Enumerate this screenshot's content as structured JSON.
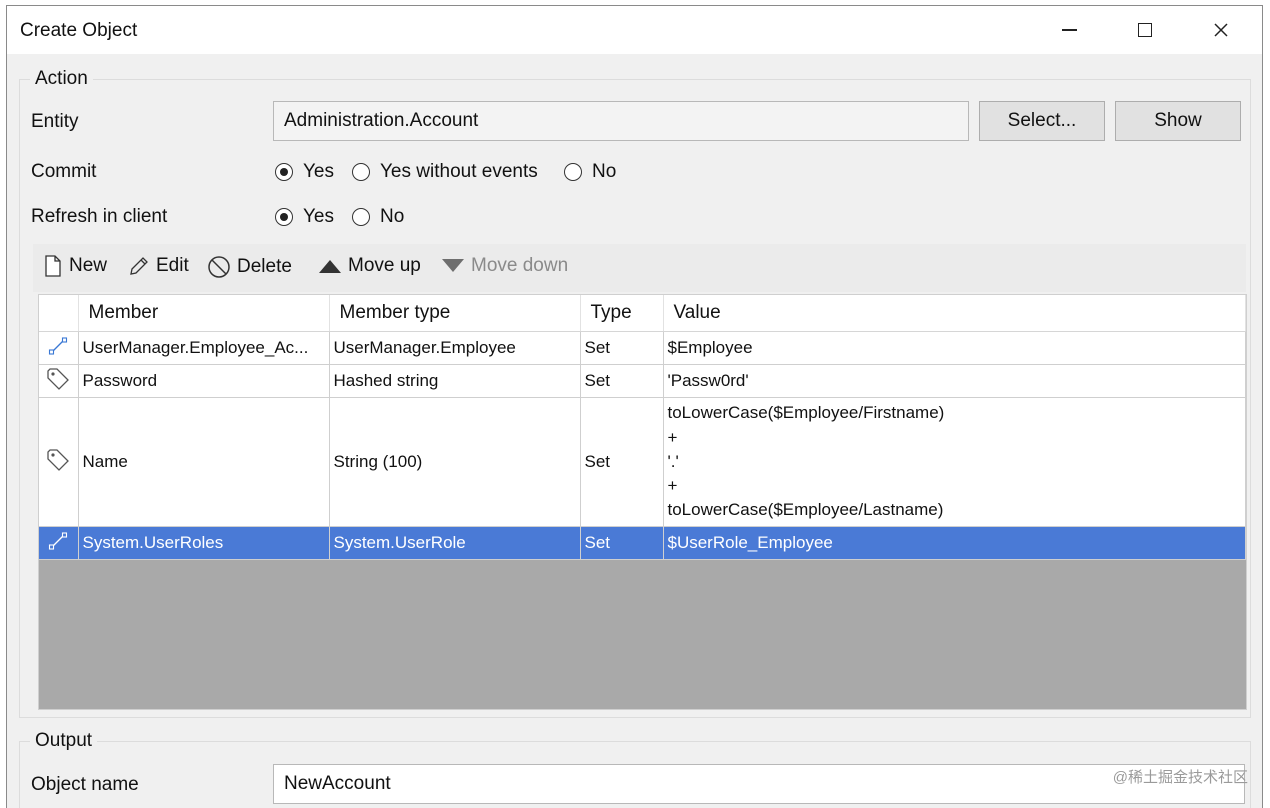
{
  "window": {
    "title": "Create Object",
    "controls": {
      "minimize": "minimize-icon",
      "maximize": "maximize-icon",
      "close": "close-icon"
    }
  },
  "action": {
    "legend": "Action",
    "entity": {
      "label": "Entity",
      "value": "Administration.Account",
      "select_label": "Select...",
      "show_label": "Show"
    },
    "commit": {
      "label": "Commit",
      "options": [
        {
          "label": "Yes",
          "checked": true
        },
        {
          "label": "Yes without events",
          "checked": false
        },
        {
          "label": "No",
          "checked": false
        }
      ]
    },
    "refresh": {
      "label": "Refresh in client",
      "options": [
        {
          "label": "Yes",
          "checked": true
        },
        {
          "label": "No",
          "checked": false
        }
      ]
    },
    "toolbar": {
      "new": "New",
      "edit": "Edit",
      "delete": "Delete",
      "move_up": "Move up",
      "move_down": "Move down"
    },
    "grid": {
      "columns": [
        "Member",
        "Member type",
        "Type",
        "Value"
      ],
      "rows": [
        {
          "icon": "association-icon",
          "member": "UserManager.Employee_Ac...",
          "member_type": "UserManager.Employee",
          "type": "Set",
          "value": "$Employee"
        },
        {
          "icon": "attribute-tag-icon",
          "member": "Password",
          "member_type": "Hashed string",
          "type": "Set",
          "value": "'Passw0rd'"
        },
        {
          "icon": "attribute-tag-icon",
          "member": "Name",
          "member_type": "String (100)",
          "type": "Set",
          "value_lines": [
            "toLowerCase($Employee/Firstname)",
            "+",
            "'.'",
            "+",
            "toLowerCase($Employee/Lastname)"
          ]
        },
        {
          "icon": "association-icon",
          "member": "System.UserRoles",
          "member_type": "System.UserRole",
          "type": "Set",
          "value": "$UserRole_Employee",
          "selected": true
        }
      ]
    }
  },
  "output": {
    "legend": "Output",
    "object_name": {
      "label": "Object name",
      "value": "NewAccount"
    }
  },
  "watermark": "@稀土掘金技术社区",
  "colors": {
    "selection": "#4a7ad6",
    "empty_grid": "#a9a9a9",
    "window_bg": "#f0f0f0"
  }
}
